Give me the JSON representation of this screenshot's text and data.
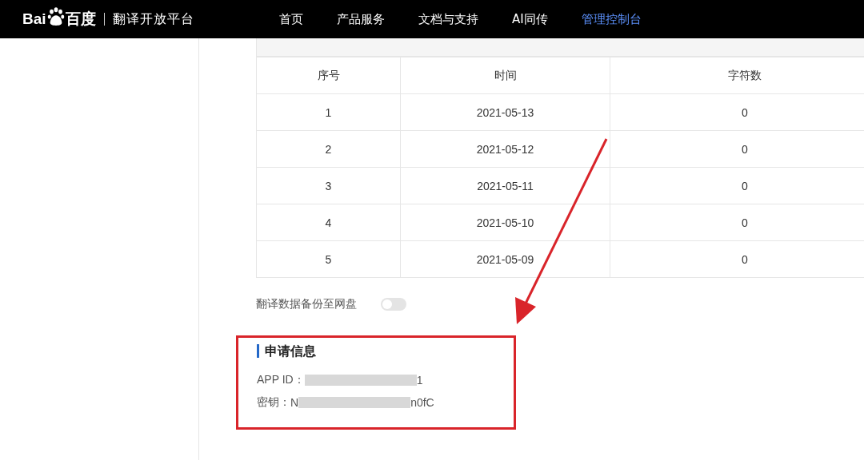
{
  "header": {
    "logo_left": "Bai",
    "logo_right": "百度",
    "product": "翻译开放平台",
    "nav": [
      {
        "label": "首页",
        "selected": false
      },
      {
        "label": "产品服务",
        "selected": false
      },
      {
        "label": "文档与支持",
        "selected": false
      },
      {
        "label": "AI同传",
        "selected": false
      },
      {
        "label": "管理控制台",
        "selected": true
      }
    ]
  },
  "table": {
    "columns": [
      "序号",
      "时间",
      "字符数"
    ],
    "rows": [
      [
        "1",
        "2021-05-13",
        "0"
      ],
      [
        "2",
        "2021-05-12",
        "0"
      ],
      [
        "3",
        "2021-05-11",
        "0"
      ],
      [
        "4",
        "2021-05-10",
        "0"
      ],
      [
        "5",
        "2021-05-09",
        "0"
      ]
    ]
  },
  "backup": {
    "label": "翻译数据备份至网盘",
    "on": false
  },
  "app_info": {
    "title": "申请信息",
    "fields": [
      {
        "label": "APP ID：",
        "suffix": "1"
      },
      {
        "label": "密钥：",
        "prefix": "N",
        "suffix": "n0fC"
      }
    ]
  }
}
